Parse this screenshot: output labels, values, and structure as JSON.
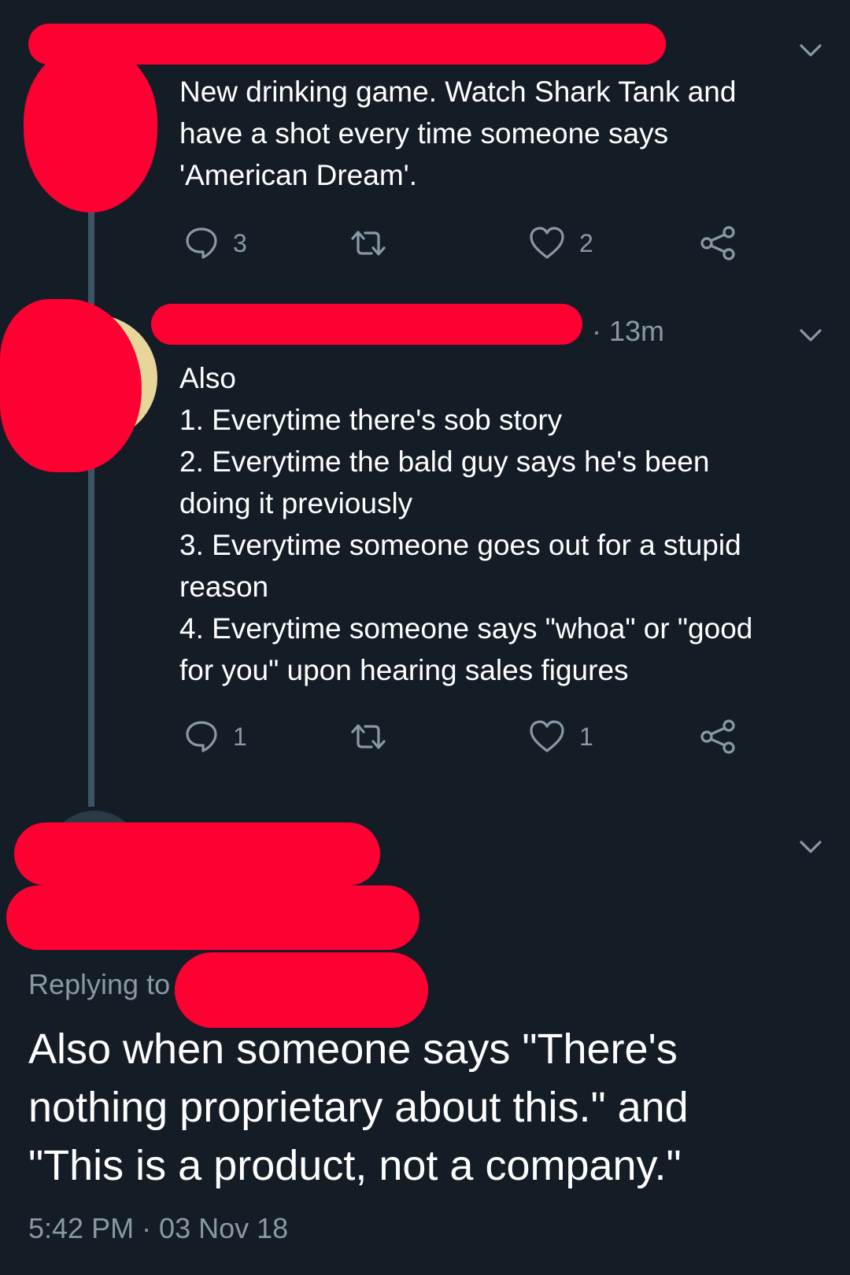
{
  "tweets": [
    {
      "text": "New drinking game. Watch Shark Tank and\nhave a shot every time someone says\n'American Dream'.",
      "reply_count": "3",
      "retweet_count": "",
      "like_count": "2"
    },
    {
      "time": "· 13m",
      "text": "Also\n1. Everytime there's sob story\n2. Everytime the bald guy says he's been\ndoing it previously\n3. Everytime someone goes out for a stupid\nreason\n4. Everytime someone says \"whoa\" or \"good\nfor you\" upon hearing sales figures",
      "reply_count": "1",
      "retweet_count": "",
      "like_count": "1"
    }
  ],
  "main_tweet": {
    "replying_to_label": "Replying to",
    "text": "Also when someone says \"There's\nnothing proprietary about this.\" and\n\"This is a product, not a company.\"",
    "timestamp": "5:42 PM · 03 Nov 18"
  },
  "icons": {
    "reply": "reply-icon",
    "retweet": "retweet-icon",
    "like": "heart-icon",
    "share": "share-icon",
    "menu": "chevron-down-icon"
  },
  "colors": {
    "background": "#141d26",
    "text_primary": "#ffffff",
    "text_secondary": "#8899a6",
    "thread_line": "#3d5466",
    "redaction": "#ff0033"
  }
}
